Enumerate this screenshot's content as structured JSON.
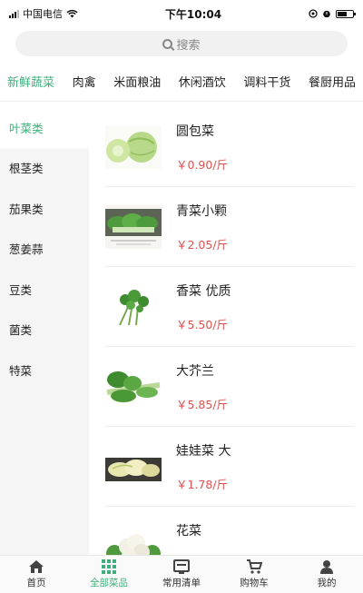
{
  "status_bar": {
    "carrier": "中国电信",
    "time": "下午10:04"
  },
  "search": {
    "placeholder": "搜索"
  },
  "category_tabs": [
    "新鲜蔬菜",
    "肉禽",
    "米面粮油",
    "休闲酒饮",
    "调料干货",
    "餐厨用品"
  ],
  "sub_categories": [
    "叶菜类",
    "根茎类",
    "茄果类",
    "葱姜蒜",
    "豆类",
    "菌类",
    "特菜"
  ],
  "products": [
    {
      "name": "圆包菜",
      "price": "￥0.90/斤",
      "icon": "cabbage"
    },
    {
      "name": "青菜小颗",
      "price": "￥2.05/斤",
      "icon": "bok-choy"
    },
    {
      "name": "香菜 优质",
      "price": "￥5.50/斤",
      "icon": "coriander"
    },
    {
      "name": "大芥兰",
      "price": "￥5.85/斤",
      "icon": "kale"
    },
    {
      "name": "娃娃菜 大",
      "price": "￥1.78/斤",
      "icon": "baby-cabbage"
    },
    {
      "name": "花菜",
      "price": "",
      "icon": "cauliflower"
    }
  ],
  "tabbar": [
    "首页",
    "全部菜品",
    "常用清单",
    "购物车",
    "我的"
  ],
  "colors": {
    "accent": "#3fb07d",
    "price": "#d9534f"
  }
}
